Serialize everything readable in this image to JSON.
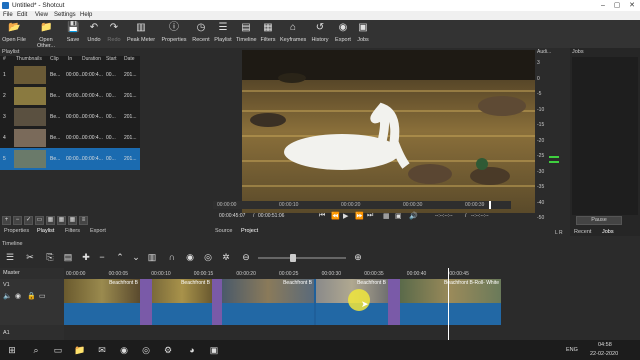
{
  "window": {
    "title": "Untitled* - Shotcut"
  },
  "menu": [
    "File",
    "Edit",
    "View",
    "Settings",
    "Help"
  ],
  "toolbar": [
    {
      "label": "Open File",
      "icon": "folder-open-icon",
      "glyph": "📂"
    },
    {
      "label": "Open Other...",
      "icon": "folder-plus-icon",
      "glyph": "📁"
    },
    {
      "label": "Save",
      "icon": "save-icon",
      "glyph": "💾"
    },
    {
      "label": "Undo",
      "icon": "undo-icon",
      "glyph": "↶"
    },
    {
      "label": "Redo",
      "icon": "redo-icon",
      "glyph": "↷"
    },
    {
      "label": "Peak Meter",
      "icon": "peak-meter-icon",
      "glyph": "▥"
    },
    {
      "label": "Properties",
      "icon": "properties-icon",
      "glyph": "ⓘ"
    },
    {
      "label": "Recent",
      "icon": "recent-icon",
      "glyph": "◷"
    },
    {
      "label": "Playlist",
      "icon": "playlist-icon",
      "glyph": "☰"
    },
    {
      "label": "Timeline",
      "icon": "timeline-icon",
      "glyph": "▤"
    },
    {
      "label": "Filters",
      "icon": "filters-icon",
      "glyph": "▦"
    },
    {
      "label": "Keyframes",
      "icon": "keyframes-icon",
      "glyph": "⌂"
    },
    {
      "label": "History",
      "icon": "history-icon",
      "glyph": "↺"
    },
    {
      "label": "Export",
      "icon": "export-icon",
      "glyph": "◉"
    },
    {
      "label": "Jobs",
      "icon": "jobs-icon",
      "glyph": "▣"
    }
  ],
  "playlist": {
    "title": "Playlist",
    "columns": [
      "#",
      "Thumbnails",
      "Clip",
      "In",
      "Duration",
      "Start",
      "Date"
    ],
    "rows": [
      {
        "n": "1",
        "clip": "Be...",
        "in": "00:00...",
        "dur": "00:00:4...",
        "start": "00...",
        "date": "201..."
      },
      {
        "n": "2",
        "clip": "Be...",
        "in": "00:00...",
        "dur": "00:00:4...",
        "start": "00...",
        "date": "201..."
      },
      {
        "n": "3",
        "clip": "Be...",
        "in": "00:00...",
        "dur": "00:00:4...",
        "start": "00...",
        "date": "201..."
      },
      {
        "n": "4",
        "clip": "Be...",
        "in": "00:00...",
        "dur": "00:00:4...",
        "start": "00...",
        "date": "201..."
      },
      {
        "n": "5",
        "clip": "Be...",
        "in": "00:00...",
        "dur": "00:00:4...",
        "start": "00...",
        "date": "201..."
      }
    ],
    "selected_row": 4,
    "tabs": [
      "Properties",
      "Playlist",
      "Filters",
      "Export"
    ]
  },
  "viewer": {
    "ruler": [
      "00:00:00",
      "00:00:10",
      "00:00:20",
      "00:00:30",
      "00:00:39"
    ],
    "position": "00:00:45:07",
    "duration": "00:00:51:06",
    "in_point": "--:--:--:--",
    "out_point": "--:--:--:--",
    "tabs": [
      "Source",
      "Project"
    ]
  },
  "audio": {
    "title": "Audi...",
    "scale": [
      "3",
      "0",
      "-5",
      "-10",
      "-15",
      "-20",
      "-25",
      "-30",
      "-35",
      "-40",
      "-50"
    ],
    "channels": "L R"
  },
  "jobs": {
    "title": "Jobs",
    "pause": "Pause",
    "tabs": [
      "Recent",
      "Jobs"
    ]
  },
  "timeline": {
    "title": "Timeline",
    "ruler": [
      "00:00:00",
      "00:00:05",
      "00:00:10",
      "00:00:15",
      "00:00:20",
      "00:00:25",
      "00:00:30",
      "00:00:35",
      "00:00:40",
      "00:00:45"
    ],
    "tracks": [
      "Master",
      "V1",
      "A1"
    ],
    "clip_labels": [
      "Beachfront B",
      "Beachfront B",
      "Beachfront B",
      "Beachfront B",
      "Beachfront B-Roll- White"
    ]
  },
  "taskbar": {
    "lang": "ENG",
    "time": "04:58",
    "date": "22-02-2020"
  },
  "colors": {
    "selection": "#1b6bb0",
    "clip": "#2268a5",
    "transition": "#7a5aa8",
    "playhead": "#ffffff"
  }
}
